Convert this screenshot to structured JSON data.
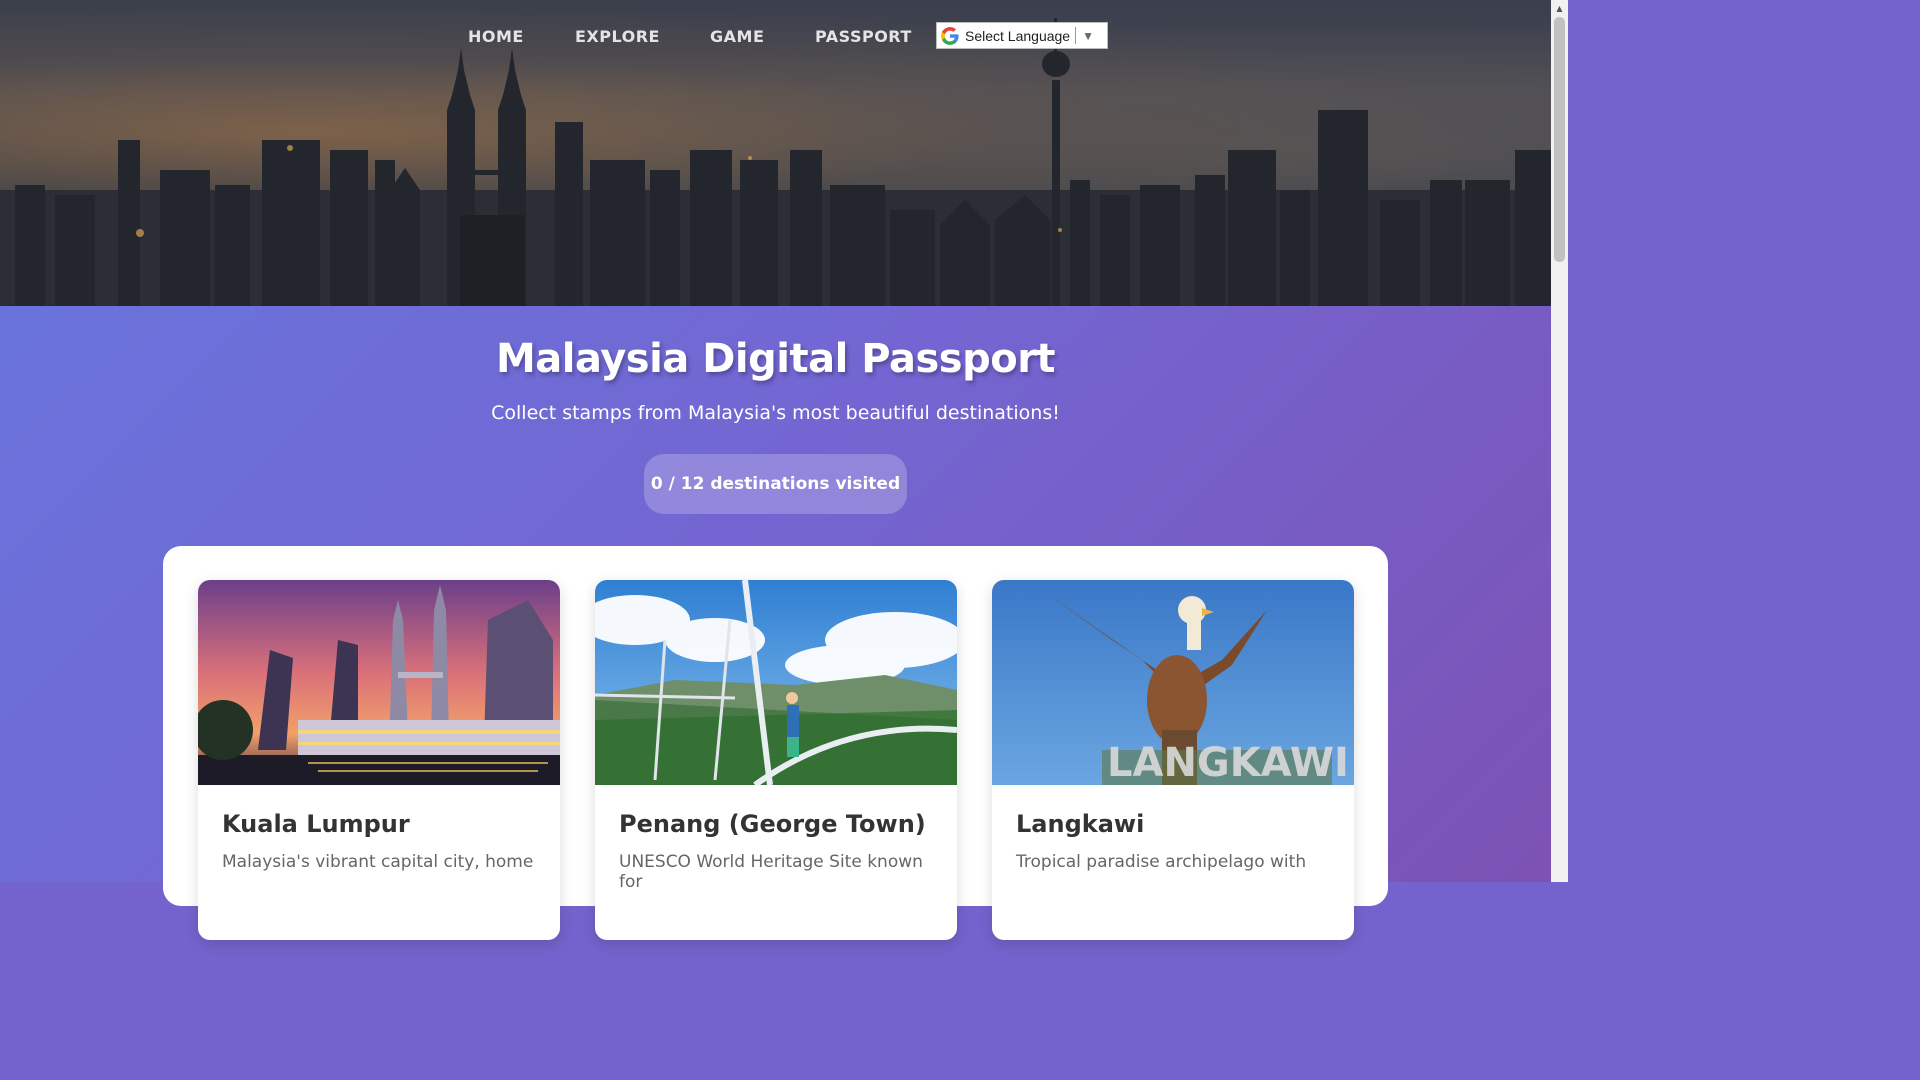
{
  "nav": {
    "links": [
      "HOME",
      "EXPLORE",
      "GAME",
      "PASSPORT"
    ],
    "language_select": {
      "label": "Select Language",
      "caret": "▼"
    }
  },
  "hero": {
    "title": "Malaysia Digital Passport",
    "subtitle": "Collect stamps from Malaysia's most beautiful destinations!",
    "visited_counter": "0 / 12 destinations visited"
  },
  "destinations": [
    {
      "name": "Kuala Lumpur",
      "description": "Malaysia's vibrant capital city, home",
      "image": "petronas-towers-night-photo"
    },
    {
      "name": "Penang (George Town)",
      "description": "UNESCO World Heritage Site known for",
      "image": "canopy-walkway-photo"
    },
    {
      "name": "Langkawi",
      "description": "Tropical paradise archipelago with",
      "image": "eagle-statue-photo",
      "image_text": "LANGKAWI"
    }
  ],
  "colors": {
    "gradient_start": "#6a73dc",
    "gradient_end": "#7c52b4",
    "nav_text": "#e4e4e4",
    "card_title": "#333333",
    "card_text": "#666666"
  }
}
